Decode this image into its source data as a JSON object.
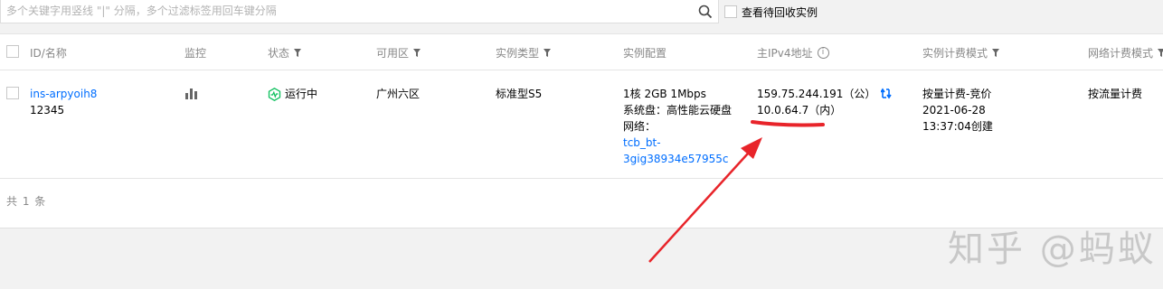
{
  "search": {
    "placeholder": "多个关键字用竖线 \"|\" 分隔，多个过滤标签用回车键分隔",
    "recycle_label": "查看待回收实例"
  },
  "table": {
    "headers": {
      "id_name": "ID/名称",
      "monitor": "监控",
      "status": "状态",
      "zone": "可用区",
      "type": "实例类型",
      "config": "实例配置",
      "ip": "主IPv4地址",
      "billing": "实例计费模式",
      "net_billing": "网络计费模式"
    },
    "rows": [
      {
        "id": "ins-arpyoih8",
        "name": "12345",
        "status": "运行中",
        "zone": "广州六区",
        "type": "标准型S5",
        "config_line1": "1核 2GB 1Mbps",
        "config_line2": "系统盘：高性能云硬盘",
        "config_line3": "网络：",
        "network_line1": "tcb_bt-",
        "network_line2": "3gig38934e57955c",
        "public_ip": "159.75.244.191（公）",
        "private_ip": "10.0.64.7（内）",
        "billing_line1": "按量计费-竞价",
        "billing_line2": "2021-06-28",
        "billing_line3": "13:37:04创建",
        "net_billing": "按流量计费"
      }
    ],
    "total": "共 1 条"
  },
  "watermark": "知乎 @蚂蚁",
  "colors": {
    "link": "#006eff",
    "status_green": "#0abf5b",
    "annotation_red": "#e8242a",
    "header_text": "#888888"
  },
  "icons": [
    "search-icon",
    "filter-icon",
    "info-icon",
    "bar-chart-icon",
    "running-status-icon",
    "swap-ip-icon"
  ]
}
